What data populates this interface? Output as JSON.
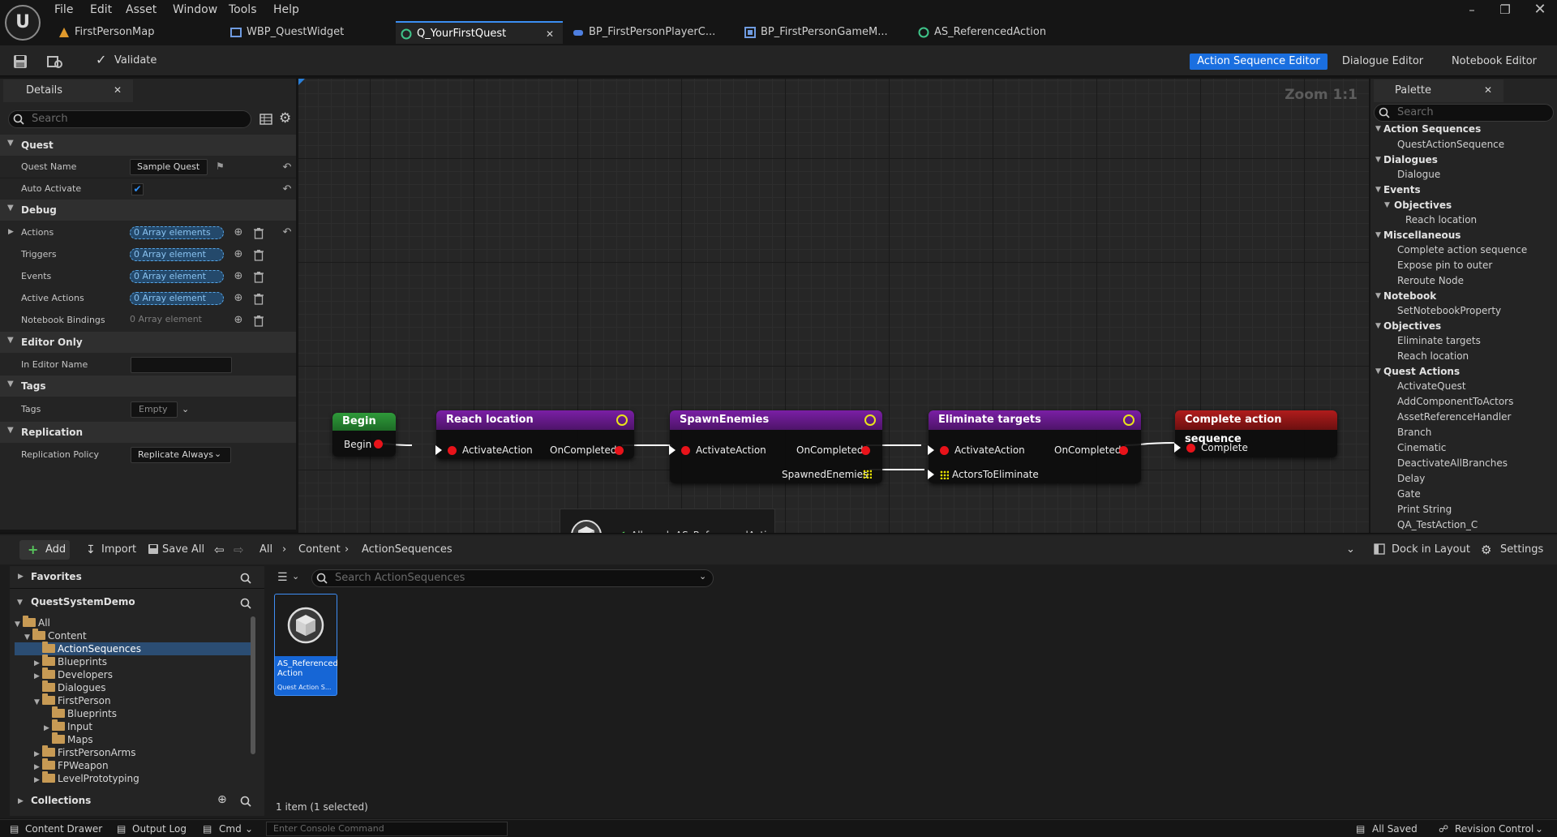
{
  "app": {
    "menu": [
      "File",
      "Edit",
      "Asset",
      "Window",
      "Tools",
      "Help"
    ],
    "tabs": [
      "FirstPersonMap",
      "WBP_QuestWidget",
      "Q_YourFirstQuest",
      "BP_FirstPersonPlayerC...",
      "BP_FirstPersonGameM...",
      "AS_ReferencedAction"
    ],
    "active_tab": "Q_YourFirstQuest",
    "accent_color": "#3b8ef3"
  },
  "toolbar": {
    "validate": "Validate",
    "modes": [
      "Action Sequence Editor",
      "Dialogue Editor",
      "Notebook Editor"
    ],
    "active_mode": "Action Sequence Editor"
  },
  "details": {
    "title": "Details",
    "search_placeholder": "Search",
    "categories": {
      "quest": "Quest",
      "debug": "Debug",
      "editor_only": "Editor Only",
      "tags": "Tags",
      "replication": "Replication"
    },
    "props": {
      "quest_name": {
        "label": "Quest Name",
        "value": "Sample Quest"
      },
      "auto_activate": {
        "label": "Auto Activate",
        "checked": true
      },
      "actions": {
        "label": "Actions",
        "value": "0 Array elements"
      },
      "triggers": {
        "label": "Triggers",
        "value": "0 Array element"
      },
      "events": {
        "label": "Events",
        "value": "0 Array element"
      },
      "active_actions": {
        "label": "Active Actions",
        "value": "0 Array element"
      },
      "notebook_bindings": {
        "label": "Notebook Bindings",
        "value": "0 Array element"
      },
      "in_editor_name": {
        "label": "In Editor Name",
        "value": ""
      },
      "tags": {
        "label": "Tags",
        "value": "Empty"
      },
      "replication_policy": {
        "label": "Replication Policy",
        "value": "Replicate Always"
      }
    }
  },
  "graph": {
    "zoom": "Zoom 1:1",
    "nodes": {
      "begin": {
        "title": "Begin",
        "out": "Begin"
      },
      "reach": {
        "title": "Reach location",
        "in": "ActivateAction",
        "out": "OnCompleted"
      },
      "spawn": {
        "title": "SpawnEnemies",
        "in": "ActivateAction",
        "out": "OnCompleted",
        "data_out": "SpawnedEnemies"
      },
      "eliminate": {
        "title": "Eliminate targets",
        "in": "ActivateAction",
        "out": "OnCompleted",
        "data_in": "ActorsToEliminate"
      },
      "complete": {
        "title": "Complete action sequence",
        "in": "Complete"
      }
    },
    "drag_tooltip": "Allowed: AS_ReferencedAction"
  },
  "palette": {
    "title": "Palette",
    "search_placeholder": "Search",
    "groups": [
      {
        "name": "Action Sequences",
        "items": [
          "QuestActionSequence"
        ]
      },
      {
        "name": "Dialogues",
        "items": [
          "Dialogue"
        ]
      },
      {
        "name": "Events",
        "sub": "Objectives",
        "items": [
          "Reach location"
        ]
      },
      {
        "name": "Miscellaneous",
        "items": [
          "Complete action sequence",
          "Expose pin to outer",
          "Reroute Node"
        ]
      },
      {
        "name": "Notebook",
        "items": [
          "SetNotebookProperty"
        ]
      },
      {
        "name": "Objectives",
        "items": [
          "Eliminate targets",
          "Reach location"
        ]
      },
      {
        "name": "Quest Actions",
        "items": [
          "ActivateQuest",
          "AddComponentToActors",
          "AssetReferenceHandler",
          "Branch",
          "Cinematic",
          "DeactivateAllBranches",
          "Delay",
          "Gate",
          "Print String",
          "QA_TestAction_C"
        ]
      }
    ]
  },
  "content_browser": {
    "add": "Add",
    "import": "Import",
    "save_all": "Save All",
    "path": [
      "All",
      "Content",
      "ActionSequences"
    ],
    "dock": "Dock in Layout",
    "settings": "Settings",
    "favorites": "Favorites",
    "project": "QuestSystemDemo",
    "search_placeholder": "Search ActionSequences",
    "tree": [
      {
        "label": "All",
        "indent": 0,
        "open": true
      },
      {
        "label": "Content",
        "indent": 1,
        "open": true
      },
      {
        "label": "ActionSequences",
        "indent": 2,
        "selected": true
      },
      {
        "label": "Blueprints",
        "indent": 2,
        "collapsed": true
      },
      {
        "label": "Developers",
        "indent": 2,
        "collapsed": true
      },
      {
        "label": "Dialogues",
        "indent": 2
      },
      {
        "label": "FirstPerson",
        "indent": 2,
        "open": true
      },
      {
        "label": "Blueprints",
        "indent": 3
      },
      {
        "label": "Input",
        "indent": 3,
        "collapsed": true
      },
      {
        "label": "Maps",
        "indent": 3
      },
      {
        "label": "FirstPersonArms",
        "indent": 2,
        "collapsed": true
      },
      {
        "label": "FPWeapon",
        "indent": 2,
        "collapsed": true
      },
      {
        "label": "LevelPrototyping",
        "indent": 2,
        "collapsed": true
      }
    ],
    "collections": "Collections",
    "asset": {
      "name": "AS_Referenced Action",
      "type": "Quest Action S..."
    },
    "item_count": "1 item (1 selected)"
  },
  "status_bar": {
    "content_drawer": "Content Drawer",
    "output_log": "Output Log",
    "cmd": "Cmd",
    "console_placeholder": "Enter Console Command",
    "all_saved": "All Saved",
    "revision_control": "Revision Control"
  }
}
